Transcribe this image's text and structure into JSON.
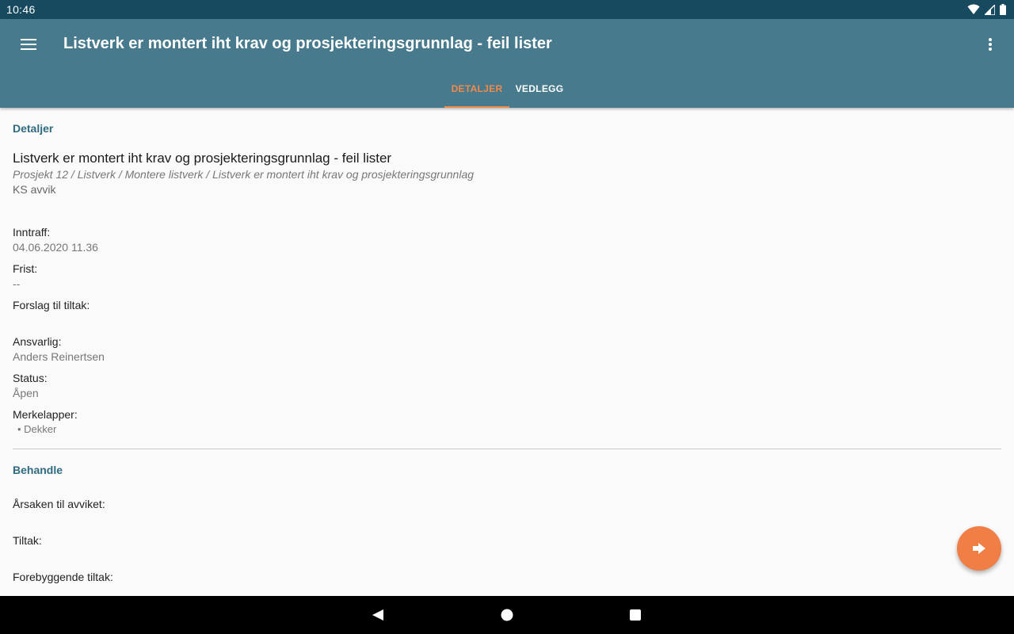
{
  "status_bar": {
    "time": "10:46",
    "icons": [
      "wifi-icon",
      "cell-signal-icon",
      "battery-icon"
    ]
  },
  "app_bar": {
    "title": "Listverk er montert iht krav og prosjekteringsgrunnlag - feil lister",
    "menu_icon": "hamburger-menu-icon",
    "overflow_icon": "more-vert-icon"
  },
  "tabs": [
    {
      "label": "DETALJER",
      "active": true
    },
    {
      "label": "VEDLEGG",
      "active": false
    }
  ],
  "details": {
    "section_title": "Detaljer",
    "item_title": "Listverk er montert iht krav og prosjekteringsgrunnlag - feil lister",
    "path": "Prosjekt 12 / Listverk / Montere listverk / Listverk er montert iht krav og prosjekteringsgrunnlag",
    "type": "KS avvik",
    "fields": [
      {
        "label": "Inntraff:",
        "value": "04.06.2020 11.36"
      },
      {
        "label": "Frist:",
        "value": "--"
      },
      {
        "label": "Forslag til tiltak:",
        "value": ""
      },
      {
        "label": "Ansvarlig:",
        "value": "Anders Reinertsen"
      },
      {
        "label": "Status:",
        "value": "Åpen"
      }
    ],
    "tags_label": "Merkelapper:",
    "tags": [
      "Dekker"
    ]
  },
  "behandle": {
    "section_title": "Behandle",
    "fields": [
      {
        "label": "Årsaken til avviket:"
      },
      {
        "label": "Tiltak:"
      },
      {
        "label": "Forebyggende tiltak:"
      }
    ]
  },
  "fab": {
    "icon": "arrow-forward-icon",
    "color": "#f07e45"
  },
  "colors": {
    "status_bar": "#174a5e",
    "app_bar": "#477a8c",
    "accent": "#f08a4b",
    "section_title": "#2f6b80"
  },
  "nav_bar": {
    "icons": [
      "back-icon",
      "home-icon",
      "recents-icon"
    ]
  }
}
